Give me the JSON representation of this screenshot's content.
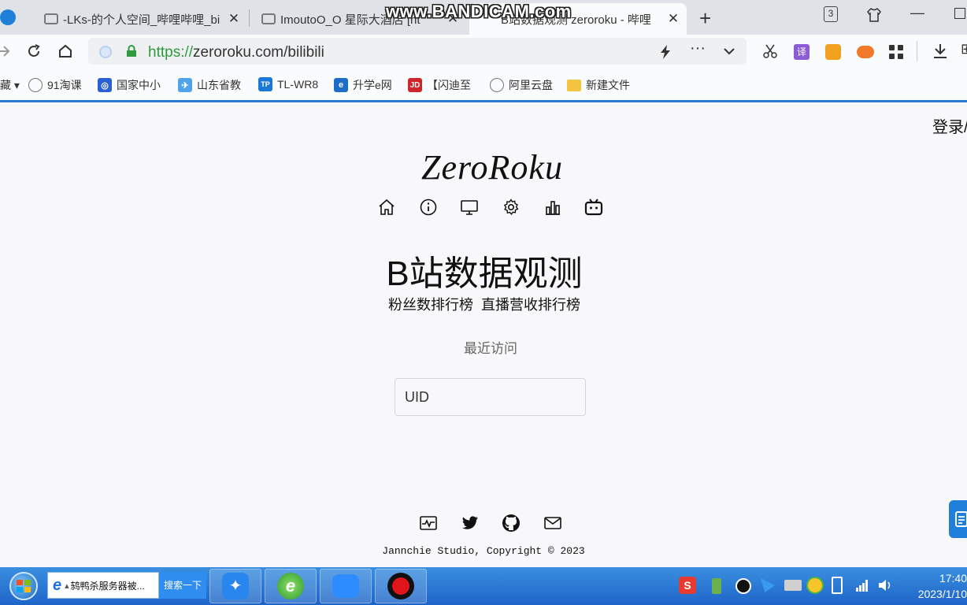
{
  "tabs": [
    {
      "label": "-LKs-的个人空间_哔哩哔哩_bi"
    },
    {
      "label": "ImoutoO_O  星际大酒店 [ht"
    },
    {
      "label": "B站数据观测 zeroroku - 哔哩"
    }
  ],
  "tab_count": "3",
  "watermark": "www.BANDICAM.com",
  "url": {
    "scheme": "https://",
    "host": "zeroroku.com/bilibili"
  },
  "bookmarks": [
    {
      "label": "91淘课",
      "icon": "globe-icon"
    },
    {
      "label": "国家中小",
      "icon": "blue-app-icon"
    },
    {
      "label": "山东省教",
      "icon": "bird-icon"
    },
    {
      "label": "TL-WR8",
      "icon": "tplink-icon"
    },
    {
      "label": "升学e网",
      "icon": "e-icon"
    },
    {
      "label": "【闪迪至",
      "icon": "jd-icon"
    },
    {
      "label": "阿里云盘",
      "icon": "globe-icon"
    },
    {
      "label": "新建文件",
      "icon": "folder-icon"
    }
  ],
  "page": {
    "login": "登录/",
    "logo": "ZeroRoku",
    "title": "B站数据观测",
    "links": [
      "粉丝数排行榜",
      "直播营收排行榜"
    ],
    "recent": "最近访问",
    "uid_placeholder": "UID",
    "copyright": "Jannchie Studio, Copyright © 2023"
  },
  "taskbar": {
    "search_text": "鸫鸭杀服务器被...",
    "search_button": "搜索一下",
    "time": "17:40",
    "date": "2023/1/10"
  },
  "colors": {
    "accent": "#2a7bd3",
    "secure_green": "#2c9c3c",
    "taskbar": "#1e64c8"
  }
}
